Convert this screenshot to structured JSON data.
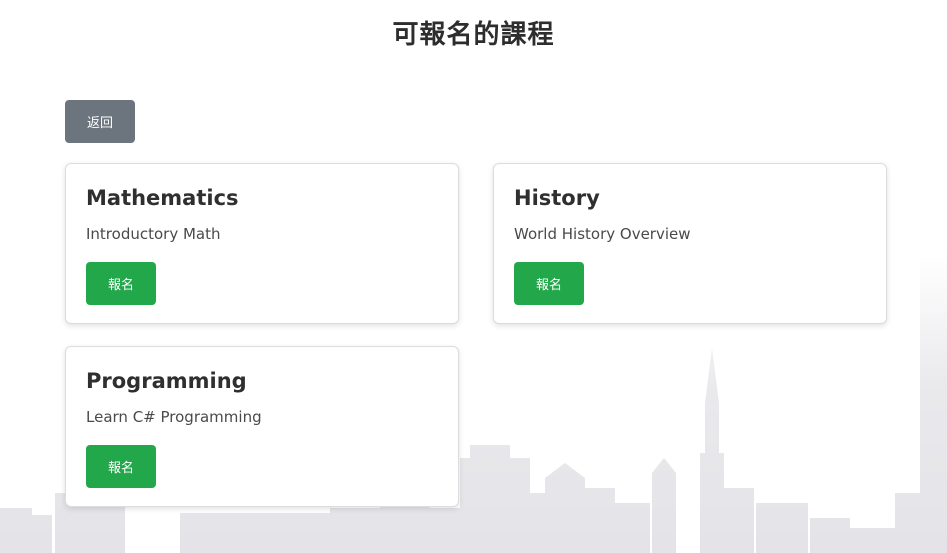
{
  "page": {
    "title": "可報名的課程",
    "back_label": "返回"
  },
  "courses": [
    {
      "name": "Mathematics",
      "description": "Introductory Math",
      "enroll_label": "報名"
    },
    {
      "name": "History",
      "description": "World History Overview",
      "enroll_label": "報名"
    },
    {
      "name": "Programming",
      "description": "Learn C# Programming",
      "enroll_label": "報名"
    }
  ],
  "colors": {
    "back_button": "#6c757d",
    "enroll_button": "#22a84a",
    "skyline": "#e6e6ea"
  },
  "icons": {
    "background": "city-skyline-illustration"
  }
}
